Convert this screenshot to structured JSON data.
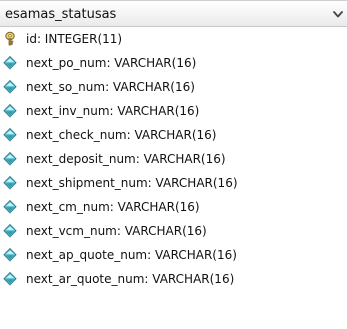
{
  "table": {
    "name": "esamas_statusas"
  },
  "icons": {
    "header_toggle": "chevron-down-icon",
    "primary_key": "key-icon",
    "column": "diamond-icon"
  },
  "colors": {
    "key": "#e6c15b",
    "diamond_top": "#c8f1f6",
    "diamond_mid": "#58bfd0",
    "diamond_bottom": "#2f8fa0"
  },
  "columns": [
    {
      "label": "id: INTEGER(11)",
      "icon": "key-icon"
    },
    {
      "label": "next_po_num: VARCHAR(16)",
      "icon": "diamond-icon"
    },
    {
      "label": "next_so_num: VARCHAR(16)",
      "icon": "diamond-icon"
    },
    {
      "label": "next_inv_num: VARCHAR(16)",
      "icon": "diamond-icon"
    },
    {
      "label": "next_check_num: VARCHAR(16)",
      "icon": "diamond-icon"
    },
    {
      "label": "next_deposit_num: VARCHAR(16)",
      "icon": "diamond-icon"
    },
    {
      "label": "next_shipment_num: VARCHAR(16)",
      "icon": "diamond-icon"
    },
    {
      "label": "next_cm_num: VARCHAR(16)",
      "icon": "diamond-icon"
    },
    {
      "label": "next_vcm_num: VARCHAR(16)",
      "icon": "diamond-icon"
    },
    {
      "label": "next_ap_quote_num: VARCHAR(16)",
      "icon": "diamond-icon"
    },
    {
      "label": "next_ar_quote_num: VARCHAR(16)",
      "icon": "diamond-icon"
    }
  ]
}
